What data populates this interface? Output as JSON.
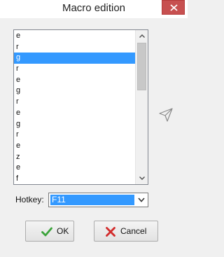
{
  "window": {
    "title": "Macro edition"
  },
  "list": {
    "items": [
      {
        "label": "e",
        "selected": false
      },
      {
        "label": "r",
        "selected": false
      },
      {
        "label": "g",
        "selected": true
      },
      {
        "label": "r",
        "selected": false
      },
      {
        "label": "e",
        "selected": false
      },
      {
        "label": "g",
        "selected": false
      },
      {
        "label": "r",
        "selected": false
      },
      {
        "label": "e",
        "selected": false
      },
      {
        "label": "g",
        "selected": false
      },
      {
        "label": "r",
        "selected": false
      },
      {
        "label": "e",
        "selected": false
      },
      {
        "label": "z",
        "selected": false
      },
      {
        "label": "e",
        "selected": false
      },
      {
        "label": "f",
        "selected": false
      }
    ]
  },
  "hotkey": {
    "label": "Hotkey:",
    "value": "F11"
  },
  "buttons": {
    "ok_label": "OK",
    "cancel_label": "Cancel"
  },
  "icons": {
    "close": "close-icon",
    "scroll_up": "chevron-up-icon",
    "scroll_down": "chevron-down-icon",
    "dropdown": "chevron-down-icon",
    "pointer": "pointer-icon",
    "ok": "checkmark-icon",
    "cancel": "x-icon"
  },
  "colors": {
    "selection": "#3399ff",
    "close_button": "#c75050",
    "ok_icon": "#3aa33a",
    "cancel_icon": "#d22b2b"
  }
}
